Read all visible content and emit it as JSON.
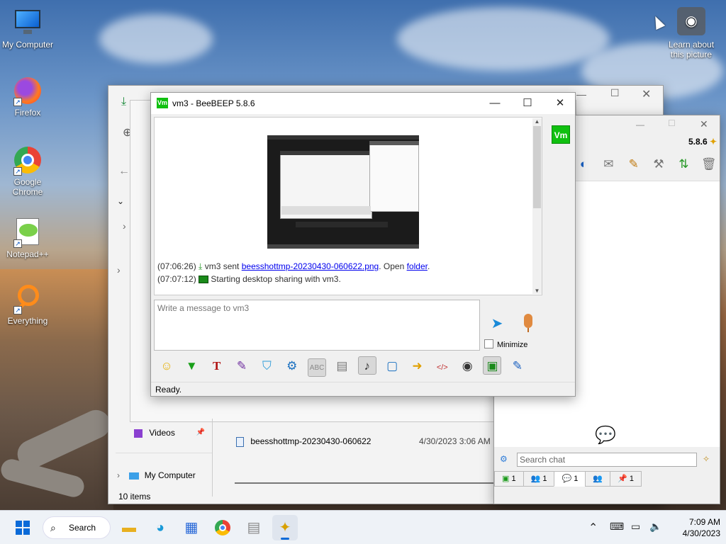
{
  "desktop": {
    "icons": [
      {
        "label": "My Computer",
        "icon": "monitor-icon"
      },
      {
        "label": "Firefox",
        "icon": "firefox-icon"
      },
      {
        "label": "Google Chrome",
        "icon": "chrome-icon"
      },
      {
        "label": "Notepad++",
        "icon": "notepadpp-icon"
      },
      {
        "label": "Everything",
        "icon": "search-magnifier-icon"
      }
    ],
    "spotlight_label": "Learn about this picture"
  },
  "explorer": {
    "nav_videos": "Videos",
    "nav_my_computer": "My Computer",
    "status": "10 items",
    "file": {
      "name": "beesshottmp-20230430-060622",
      "date": "4/30/2023 3:06 AM"
    }
  },
  "beebeep_main": {
    "version": "5.8.6",
    "search_placeholder": "Search chat",
    "tabs": [
      {
        "label": "1",
        "icon": "chat-screen-icon"
      },
      {
        "label": "1",
        "icon": "users-icon"
      },
      {
        "label": "1",
        "icon": "chat-bubbles-icon"
      },
      {
        "label": "",
        "icon": "group-icon"
      },
      {
        "label": "1",
        "icon": "pin-icon"
      }
    ]
  },
  "chat_window": {
    "title": "vm3 - BeeBEEP 5.8.6",
    "avatar": "Vm",
    "messages": [
      {
        "time": "(07:06:26)",
        "pre": "vm3 sent ",
        "link": "beesshottmp-20230430-060622.png",
        "mid": ". Open ",
        "link2": "folder",
        "post": "."
      },
      {
        "time": "(07:07:12)",
        "text": "Starting desktop sharing with vm3."
      }
    ],
    "input_placeholder": "Write a message to vm3",
    "minimize_label": "Minimize",
    "status": "Ready."
  },
  "taskbar": {
    "search_label": "Search",
    "time": "7:09 AM",
    "date": "4/30/2023"
  },
  "colors": {
    "beebeep_green": "#10c010",
    "link": "#0000ee",
    "taskbar": "#eef2f7"
  }
}
